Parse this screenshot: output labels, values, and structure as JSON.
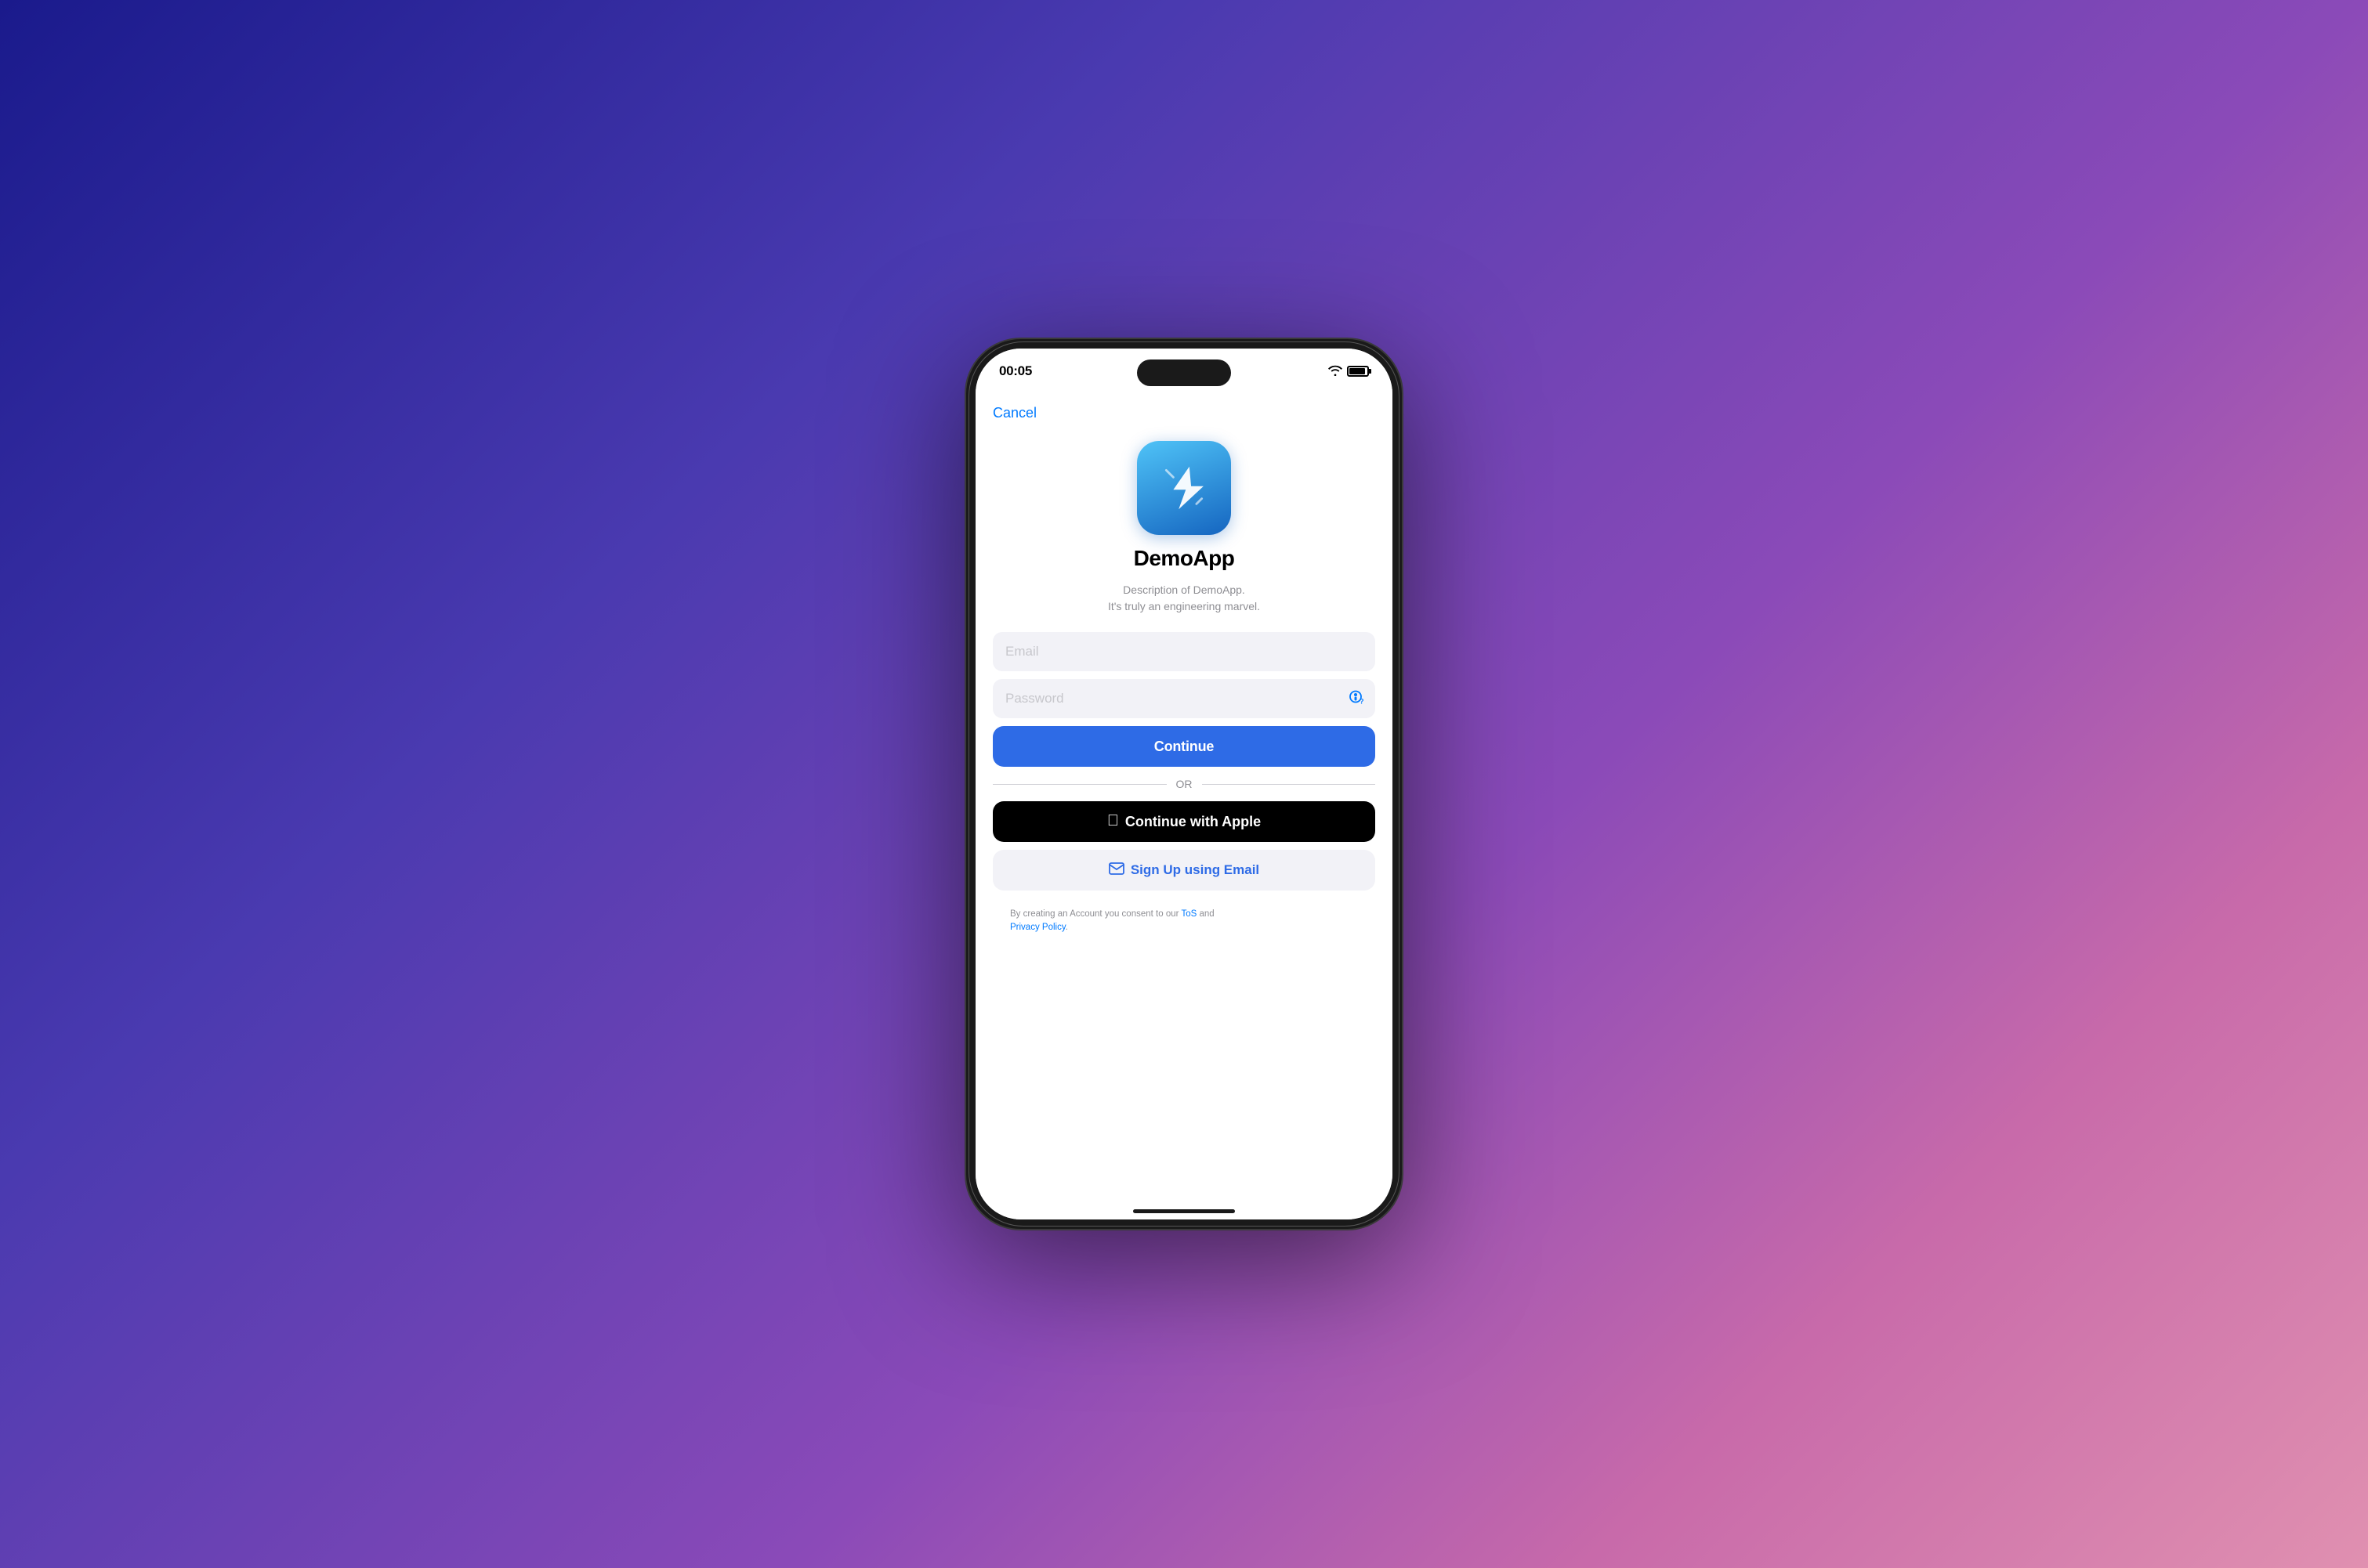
{
  "background": {
    "gradient_start": "#1a1a8c",
    "gradient_end": "#e090b0"
  },
  "status_bar": {
    "time": "00:05",
    "wifi": "wifi",
    "battery": "battery"
  },
  "screen": {
    "cancel_label": "Cancel",
    "app_name": "DemoApp",
    "app_description_line1": "Description of DemoApp.",
    "app_description_line2": "It's truly an engineering marvel.",
    "email_placeholder": "Email",
    "password_placeholder": "Password",
    "continue_button_label": "Continue",
    "or_divider": "OR",
    "apple_button_label": "Continue with Apple",
    "signup_email_label": "Sign Up using Email",
    "footer_text": "By creating an Account you consent to our ",
    "footer_tos": "ToS",
    "footer_and": " and ",
    "footer_privacy": "Privacy Policy",
    "footer_period": "."
  }
}
